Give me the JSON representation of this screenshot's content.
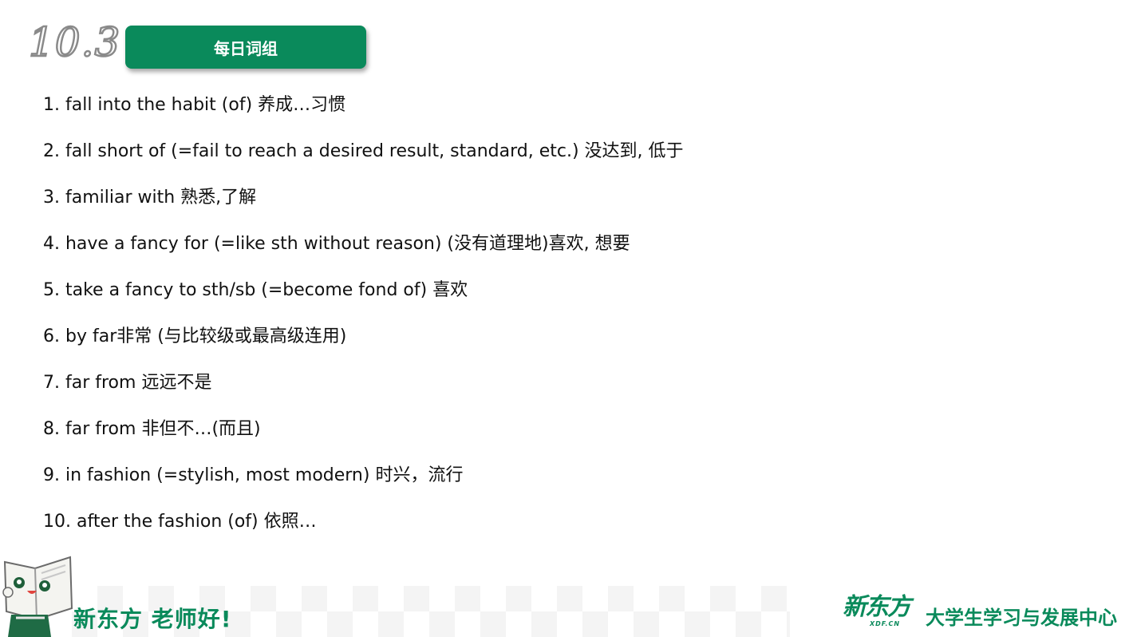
{
  "header": {
    "date": "10.3",
    "title": "每日词组"
  },
  "phrases": [
    "1. fall into the habit (of) 养成…习惯",
    "2. fall short of (=fail to reach a desired result, standard, etc.) 没达到, 低于",
    "3. familiar with 熟悉,了解",
    "4. have a fancy for (=like sth without reason) (没有道理地)喜欢, 想要",
    "5. take a fancy to sth/sb (=become fond of) 喜欢",
    "6. by far非常 (与比较级或最高级连用)",
    "7. far from 远远不是",
    "8. far from 非但不…(而且)",
    "9. in fashion (=stylish, most modern) 时兴，流行",
    "10. after the fashion (of) 依照…"
  ],
  "footer": {
    "greeting": "新东方 老师好!",
    "brand_name": "新东方",
    "brand_sub": "XDF.CN",
    "center_name": "大学生学习与发展中心"
  },
  "colors": {
    "brand_green": "#0a8a5b",
    "date_outline": "#8a8a8a"
  }
}
